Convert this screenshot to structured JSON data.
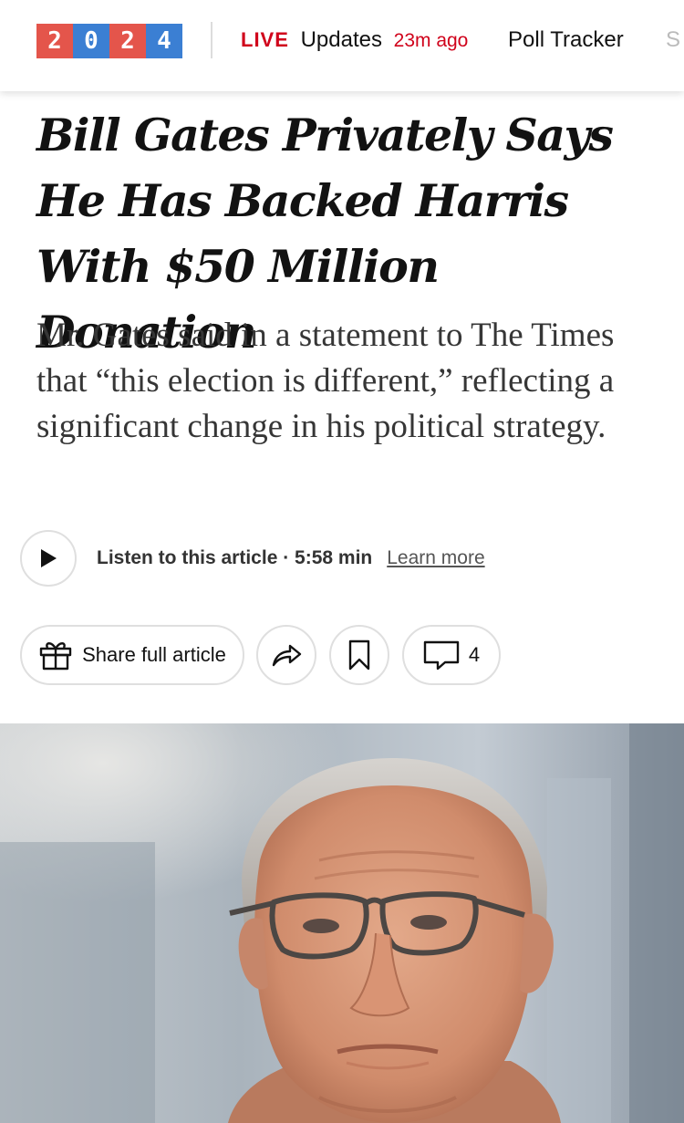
{
  "nav": {
    "logo_digits": [
      "2",
      "0",
      "2",
      "4"
    ],
    "logo_colors": [
      "#e4554b",
      "#3b7fd3",
      "#e4554b",
      "#3b7fd3"
    ],
    "live_tag": "LIVE",
    "live_text": "Updates",
    "live_time": "23m ago",
    "poll_tracker": "Poll Tracker",
    "next_item_partial": "S"
  },
  "article": {
    "headline": "Bill Gates Privately Says He Has Backed Harris With $50 Million Donation",
    "summary": "Mr. Gates said in a statement to The Times that “this election is different,” reflecting a significant change in his political strategy."
  },
  "audio": {
    "listen_label": "Listen to this article · 5:58 min",
    "learn_more": "Learn more",
    "play_icon": "play-icon"
  },
  "actions": {
    "share_full_article": "Share full article",
    "comment_count": "4",
    "icons": [
      "gift-icon",
      "share-arrow-icon",
      "bookmark-icon",
      "comment-icon"
    ]
  },
  "colors": {
    "accent_red": "#d0021b",
    "text": "#121212",
    "summary_text": "#363636"
  }
}
